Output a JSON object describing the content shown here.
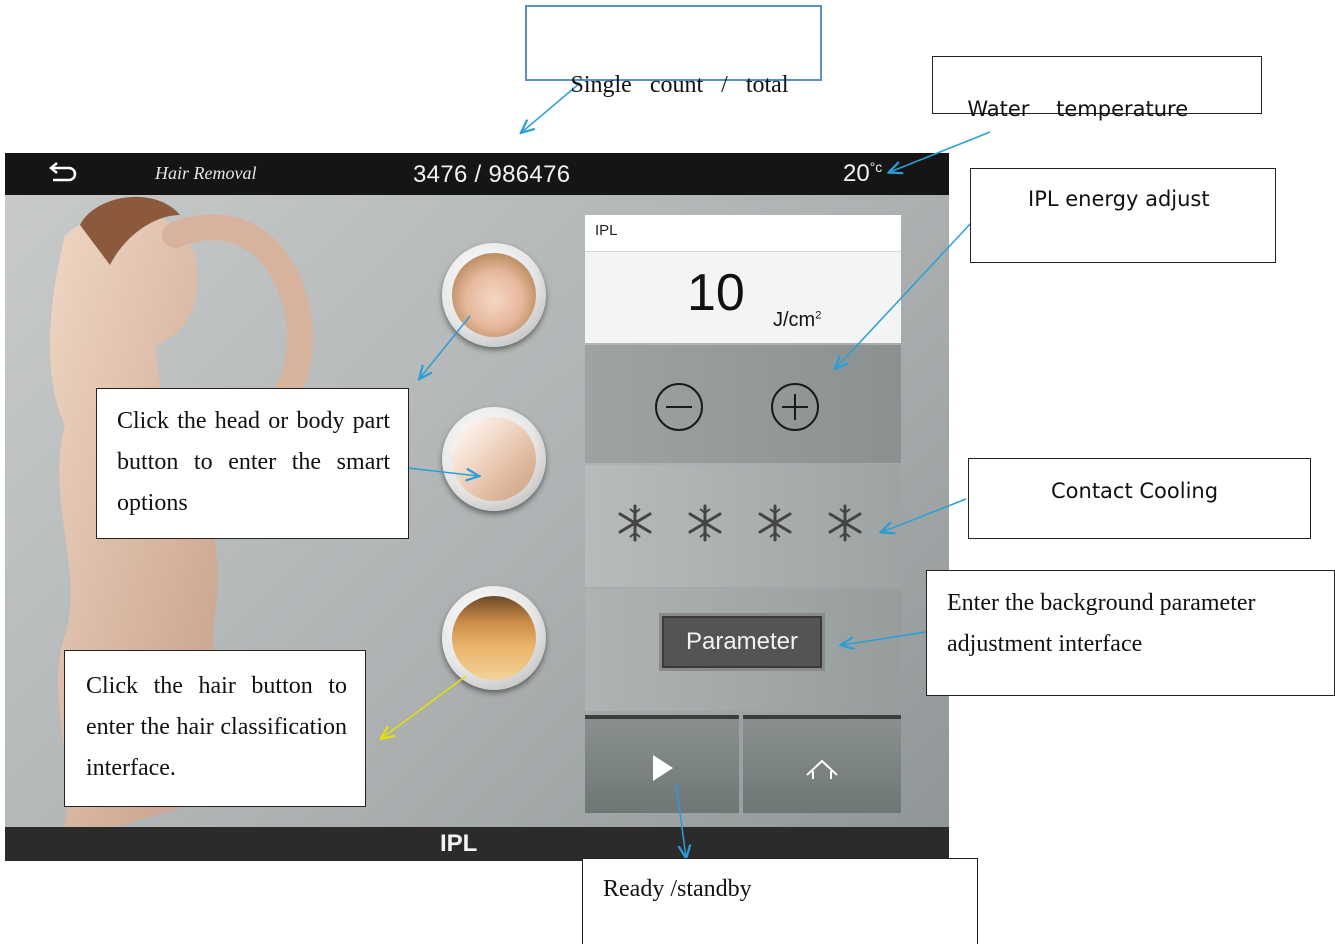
{
  "device": {
    "title": "Hair Removal",
    "counter": "3476 / 986476",
    "temperature_value": "20",
    "temperature_unit": "°c",
    "mode_label": "IPL",
    "ipl_label": "IPL",
    "energy_value": "10",
    "energy_unit": "J/cm",
    "energy_unit_sup": "2",
    "parameter_button": "Parameter"
  },
  "callouts": {
    "single_count": "Single   count   /   total",
    "water_temp": "Water    temperature",
    "energy_adjust": "IPL energy adjust",
    "body_part": "Click the head or body part button to enter the smart options",
    "contact_cooling": "Contact Cooling",
    "background_param": "Enter the background parameter adjustment interface",
    "hair_button": "Click the hair button to enter the hair classification interface.",
    "ready": "Ready /standby"
  },
  "colors": {
    "topbar": "#151515",
    "bottombar": "#2b2b2b",
    "arrow_blue": "#2a9fd6",
    "arrow_yellow": "#e8e000",
    "callout_blue_border": "#5b8fc7"
  }
}
